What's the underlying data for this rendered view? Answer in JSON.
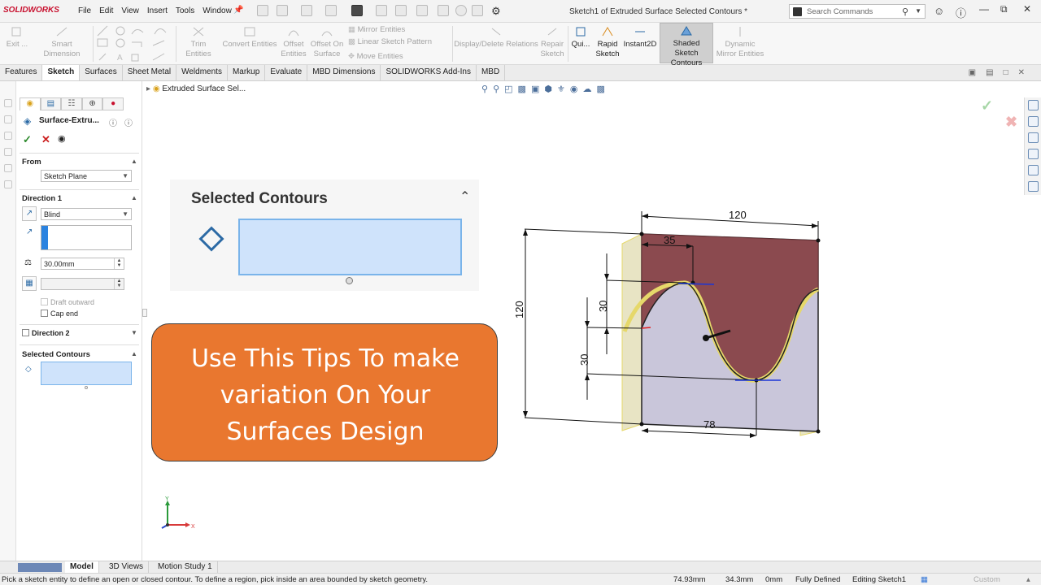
{
  "app": {
    "logo": "SOLIDWORKS",
    "menus": [
      "File",
      "Edit",
      "View",
      "Insert",
      "Tools",
      "Window"
    ],
    "document_title": "Sketch1 of Extruded Surface Selected Contours *",
    "search_placeholder": "Search Commands"
  },
  "ribbon": {
    "exit": "Exit ...",
    "smart_dimension": "Smart Dimension",
    "trim_entities": "Trim Entities",
    "convert_entities": "Convert Entities",
    "offset_entities_1": "Offset",
    "offset_entities_2": "Entities",
    "offset_on_surface_1": "Offset On",
    "offset_on_surface_2": "Surface",
    "mirror_entities": "Mirror Entities",
    "linear_pattern": "Linear Sketch Pattern",
    "move_entities": "Move Entities",
    "display_delete": "Display/Delete Relations",
    "repair_1": "Repair",
    "repair_2": "Sketch",
    "quick": "Qui...",
    "rapid_1": "Rapid",
    "rapid_2": "Sketch",
    "instant2d": "Instant2D",
    "shaded_1": "Shaded Sketch",
    "shaded_2": "Contours",
    "dynamic_1": "Dynamic",
    "dynamic_2": "Mirror Entities"
  },
  "tabs": [
    "Features",
    "Sketch",
    "Surfaces",
    "Sheet Metal",
    "Weldments",
    "Markup",
    "Evaluate",
    "MBD Dimensions",
    "SOLIDWORKS Add-Ins",
    "MBD"
  ],
  "active_tab": "Sketch",
  "property_manager": {
    "title": "Surface-Extru...",
    "from_label": "From",
    "from_value": "Sketch Plane",
    "direction1_label": "Direction 1",
    "end_condition": "Blind",
    "depth": "30.00mm",
    "draft_outward": "Draft outward",
    "cap_end": "Cap end",
    "direction2_label": "Direction 2",
    "selected_contours_label": "Selected Contours"
  },
  "graphics": {
    "flyout_tree": "Extruded Surface Sel...",
    "callout_title": "Selected Contours",
    "tip_lines": [
      "Use This Tips To make",
      "variation On Your",
      "Surfaces Design"
    ],
    "dimensions": {
      "width": "120",
      "height": "120",
      "d35": "35",
      "d30a": "30",
      "d30b": "30",
      "d78": "78"
    },
    "triad_y": "Y",
    "triad_x": "X"
  },
  "bottom_tabs": [
    "Model",
    "3D Views",
    "Motion Study 1"
  ],
  "status": {
    "message": "Pick a sketch entity to define an open or closed contour. To define a region, pick inside an area bounded by sketch geometry.",
    "x": "74.93mm",
    "y": "34.3mm",
    "z": "0mm",
    "state": "Fully Defined",
    "editing": "Editing Sketch1",
    "units": "Custom"
  },
  "colors": {
    "tip_fill": "#e9772f",
    "selection_blue": "#cfe3fb",
    "surface_maroon": "#8b4a4f",
    "accent_red": "#c8102e"
  }
}
